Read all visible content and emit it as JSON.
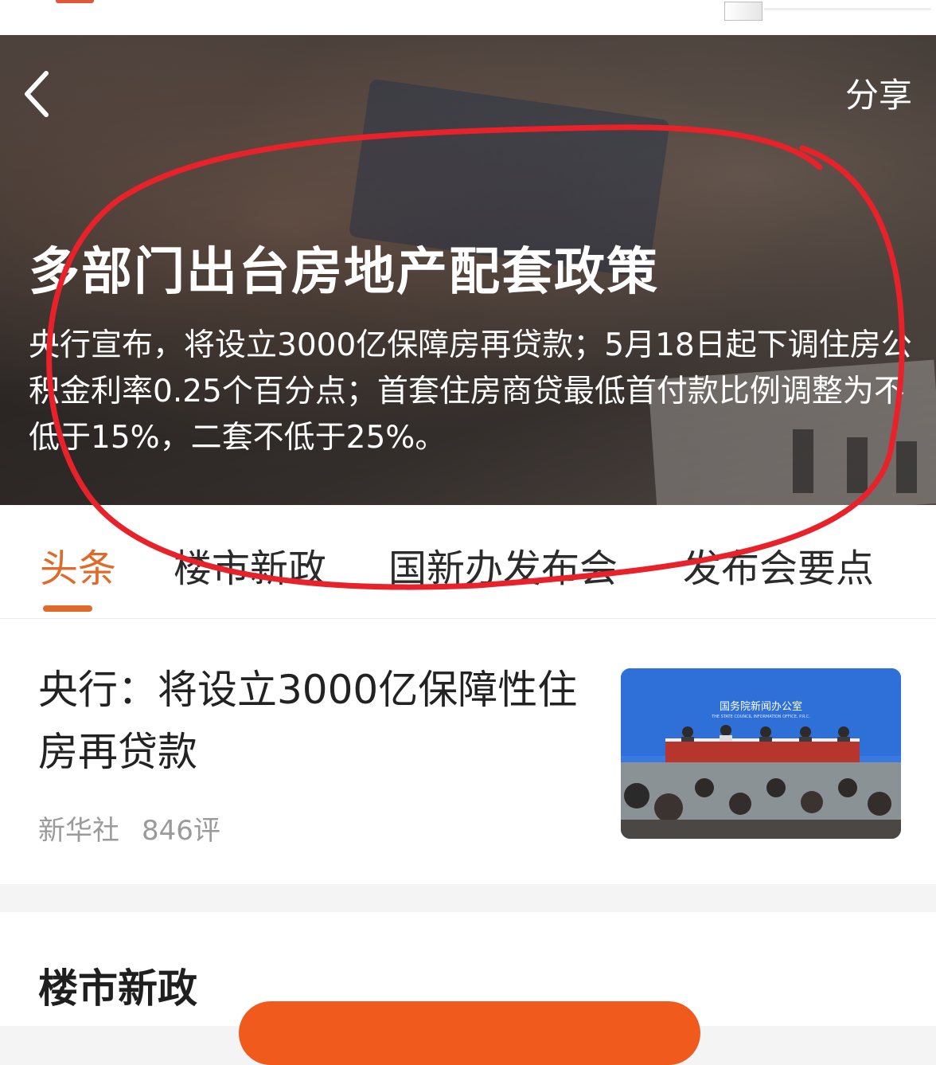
{
  "header": {
    "back_label": "<",
    "share_label": "分享"
  },
  "hero": {
    "title": "多部门出台房地产配套政策",
    "summary": "央行宣布，将设立3000亿保障房再贷款；5月18日起下调住房公积金利率0.25个百分点；首套住房商贷最低首付款比例调整为不低于15%，二套不低于25%。"
  },
  "tabs": [
    {
      "label": "头条",
      "active": true
    },
    {
      "label": "楼市新政",
      "active": false
    },
    {
      "label": "国新办发布会",
      "active": false
    },
    {
      "label": "发布会要点",
      "active": false
    }
  ],
  "news": [
    {
      "title": "央行：将设立3000亿保障性住房再贷款",
      "source": "新华社",
      "comments": "846评",
      "thumbnail": {
        "backdrop_text_cn": "国务院新闻办公室",
        "backdrop_text_en": "THE STATE COUNCIL INFORMATION OFFICE, P.R.C."
      }
    }
  ],
  "section": {
    "title": "楼市新政"
  },
  "colors": {
    "accent": "#e06a2a",
    "annotation": "#e8222a",
    "pill": "#f05a1d"
  }
}
